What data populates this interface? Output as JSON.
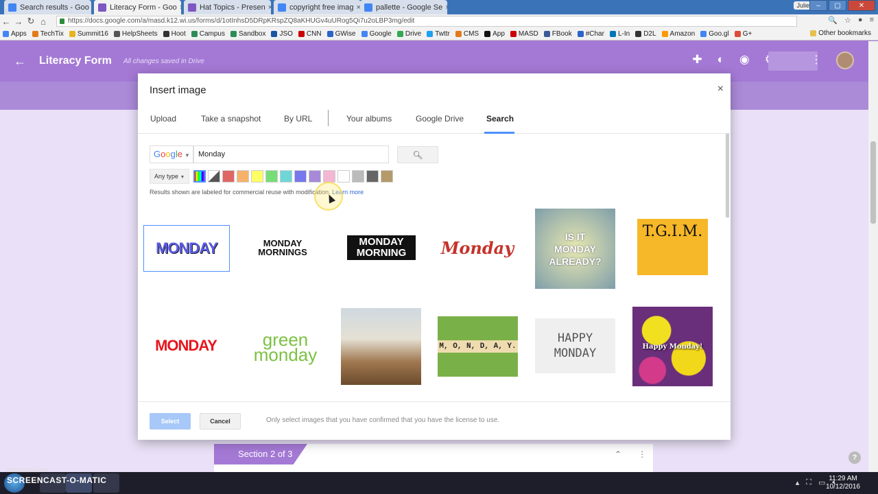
{
  "browser": {
    "tabs": [
      {
        "title": "Search results - Goo",
        "color": "#4285f4",
        "active": false
      },
      {
        "title": "Literacy Form - Goo",
        "color": "#7e57c2",
        "active": true
      },
      {
        "title": "Hat Topics - Presen",
        "color": "#7e57c2",
        "active": false
      },
      {
        "title": "copyright free imag",
        "color": "#4285f4",
        "active": false
      },
      {
        "title": "pallette - Google Se",
        "color": "#4285f4",
        "active": false
      }
    ],
    "user": "Julie",
    "url": "https://docs.google.com/a/masd.k12.wi.us/forms/d/1otInhsD5DRpKRspZQ8aKHUGv4uURog5Qi7u2oLBP3mg/edit",
    "bookmarks": [
      "Apps",
      "TechTix",
      "Summit16",
      "HelpSheets",
      "Hoot",
      "Campus",
      "Sandbox",
      "JSO",
      "CNN",
      "GWise",
      "Google",
      "Drive",
      "Twttr",
      "CMS",
      "App",
      "MASD",
      "FBook",
      "#Char",
      "L-In",
      "D2L",
      "Amazon",
      "Goo.gl",
      "G+"
    ],
    "bookmark_colors": [
      "#4285f4",
      "#e37b1a",
      "#e8b21a",
      "#555",
      "#333",
      "#2e8b57",
      "#2e8b57",
      "#1a55a5",
      "#c00",
      "#2a64c8",
      "#4285f4",
      "#34a853",
      "#1da1f2",
      "#e37b1a",
      "#111",
      "#c00",
      "#3b5998",
      "#2a64c8",
      "#0077b5",
      "#333",
      "#f90",
      "#4285f4",
      "#dd4b39"
    ],
    "other_bookmarks": "Other bookmarks"
  },
  "form": {
    "title": "Literacy Form",
    "save_status": "All changes saved in Drive",
    "section_label": "Section 2 of 3"
  },
  "dialog": {
    "title": "Insert image",
    "close": "×",
    "tabs": [
      "Upload",
      "Take a snapshot",
      "By URL",
      "Your albums",
      "Google Drive",
      "Search"
    ],
    "active_tab": "Search",
    "search_engine": "Google",
    "search_query": "Monday",
    "type_filter": "Any type",
    "notice": "Results shown are labeled for commercial reuse with modification.",
    "learn_more": "Learn more",
    "select_label": "Select",
    "cancel_label": "Cancel",
    "license_note": "Only select images that you have confirmed that you have the license to use.",
    "swatch_colors": [
      "multi",
      "bw",
      "#e06666",
      "#f6b26b",
      "#ffff66",
      "#77dd77",
      "#6fd6d6",
      "#7777ee",
      "#a68ad8",
      "#f4b6d2",
      "#ffffff",
      "#bbbbbb",
      "#666666",
      "#b59a6a"
    ]
  },
  "results": [
    {
      "text": "MONDAY",
      "style": "blue"
    },
    {
      "text": "MONDAY MORNINGS",
      "style": "mornings"
    },
    {
      "text": "MONDAY MORNING",
      "style": "morning"
    },
    {
      "text": "Monday",
      "style": "red-script"
    },
    {
      "text": "IS IT MONDAY ALREADY?",
      "style": "poster"
    },
    {
      "text": "T.G.I.M.",
      "style": "tgim"
    },
    {
      "text": "MONDAY",
      "style": "red-bold"
    },
    {
      "text": "green monday",
      "style": "green"
    },
    {
      "text": "",
      "style": "photo-desk"
    },
    {
      "text": "M, O, N, D, A, Y.",
      "style": "scrabble"
    },
    {
      "text": "HAPPY MONDAY",
      "style": "chalk"
    },
    {
      "text": "Happy Monday!",
      "style": "flowers"
    }
  ],
  "taskbar": {
    "recorded_with": "RECORDED WITH",
    "app": "SCREENCAST-O-MATIC",
    "time": "11:29 AM",
    "date": "10/12/2016"
  }
}
